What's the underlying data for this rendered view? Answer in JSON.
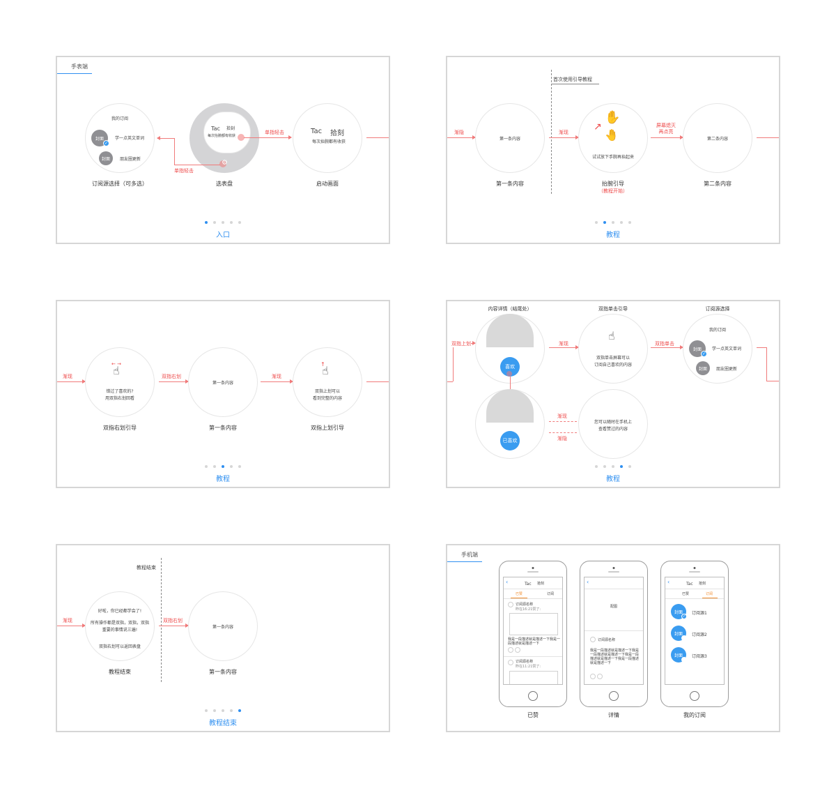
{
  "panels": {
    "p1": {
      "tag": "手表端",
      "title": "入口",
      "sub_title": "我的订阅",
      "cover": "封面",
      "sub1": "学一点英文单词",
      "sub2": "朋友圈更新",
      "dial_tac": "Tac",
      "dial_moment": "拾刻",
      "dial_sub": "每次抬腕都有收获",
      "tap_label1": "单指轻击",
      "tap_label2": "单指轻击",
      "launch_tac": "Tac",
      "launch_moment": "拾刻",
      "launch_sub": "每次抬腕都有收获",
      "cap1": "订阅源选择（可多选）",
      "cap2": "选表盘",
      "cap3": "启动画面",
      "dots": [
        true,
        false,
        false,
        false,
        false
      ]
    },
    "p2": {
      "title": "教程",
      "first_use": "首次使用引导教程",
      "fade_out": "渐隐",
      "fade_in": "渐现",
      "screen_off_1": "屏幕熄灭",
      "screen_off_2": "再点亮",
      "content1": "第一条内容",
      "raise_tip": "试试放下手腕再抬起来",
      "content2": "第二条内容",
      "cap1": "第一条内容",
      "cap2": "抬腕引导",
      "cap2b": "（教程开始）",
      "cap3": "第二条内容",
      "dots": [
        false,
        true,
        false,
        false,
        false
      ]
    },
    "p3": {
      "title": "教程",
      "fade_in": "渐现",
      "swipe_right": "双指右划",
      "fade_in2": "渐现",
      "tip1a": "错过了喜欢的?",
      "tip1b": "用双指右划回看",
      "content": "第一条内容",
      "tip3a": "双指上划可以",
      "tip3b": "看到完整的内容",
      "cap1": "双指右划引导",
      "cap2": "第一条内容",
      "cap3": "双指上划引导",
      "dots": [
        false,
        false,
        true,
        false,
        false
      ]
    },
    "p4": {
      "title": "教程",
      "head1": "内容详情（结尾处）",
      "head2": "双指单击引导",
      "head3": "订阅源选择",
      "swipe_up": "双指上划",
      "fade_in": "渐现",
      "double_tap": "双指单击",
      "like": "喜欢",
      "liked": "已喜欢",
      "tip2a": "双指单击屏幕可以",
      "tip2b": "订阅自己喜欢的内容",
      "my_sub": "我的订阅",
      "cover": "封面",
      "sub1": "学一点英文单词",
      "sub2": "朋友圈更新",
      "fade_in2": "渐现",
      "fade_out": "渐隐",
      "tip4a": "您可以随时在手机上",
      "tip4b": "查看赞过的内容",
      "dots": [
        false,
        false,
        false,
        true,
        false
      ]
    },
    "p5": {
      "title": "教程结束",
      "end_label": "教程结束",
      "fade_in": "渐现",
      "swipe_right": "双指右划",
      "msg1": "好啦，你已经都学会了!",
      "msg2": "所有操作都是双指，双指，双指",
      "msg3": "重要的事情说三遍!",
      "msg4": "双指右划可以返回表盘",
      "content": "第一条内容",
      "cap1": "教程结束",
      "cap2": "第一条内容",
      "dots": [
        false,
        false,
        false,
        false,
        true
      ]
    },
    "p6": {
      "tag": "手机端",
      "phone1": {
        "title_tac": "Tac",
        "title_moment": "拾刻",
        "tab1": "已赞",
        "tab2": "订阅",
        "item1_name": "订阅源名称",
        "item1_time": "昨在16:21赞了:",
        "desc": "我是一段描述就是描述一下我是一段描述就是描述一下",
        "item2_name": "订阅源名称",
        "item2_time": "昨在11:21赞了:"
      },
      "phone2": {
        "image": "配图",
        "name": "订阅源名称",
        "desc": "我是一段描述就是描述一下我是一段描述就是描述一下我是一段描述就是描述一下我是一段描述就是描述一下"
      },
      "phone3": {
        "title_tac": "Tac",
        "title_moment": "拾刻",
        "tab1": "已赞",
        "tab2": "订阅",
        "cover": "封面",
        "src1": "订阅源1",
        "src2": "订阅源2",
        "src3": "订阅源3"
      },
      "cap1": "已赞",
      "cap2": "详情",
      "cap3": "我的订阅"
    }
  },
  "colors": {
    "accent": "#2f8ff0",
    "highlight": "#ee4a4a",
    "border": "#d6d6d6"
  }
}
